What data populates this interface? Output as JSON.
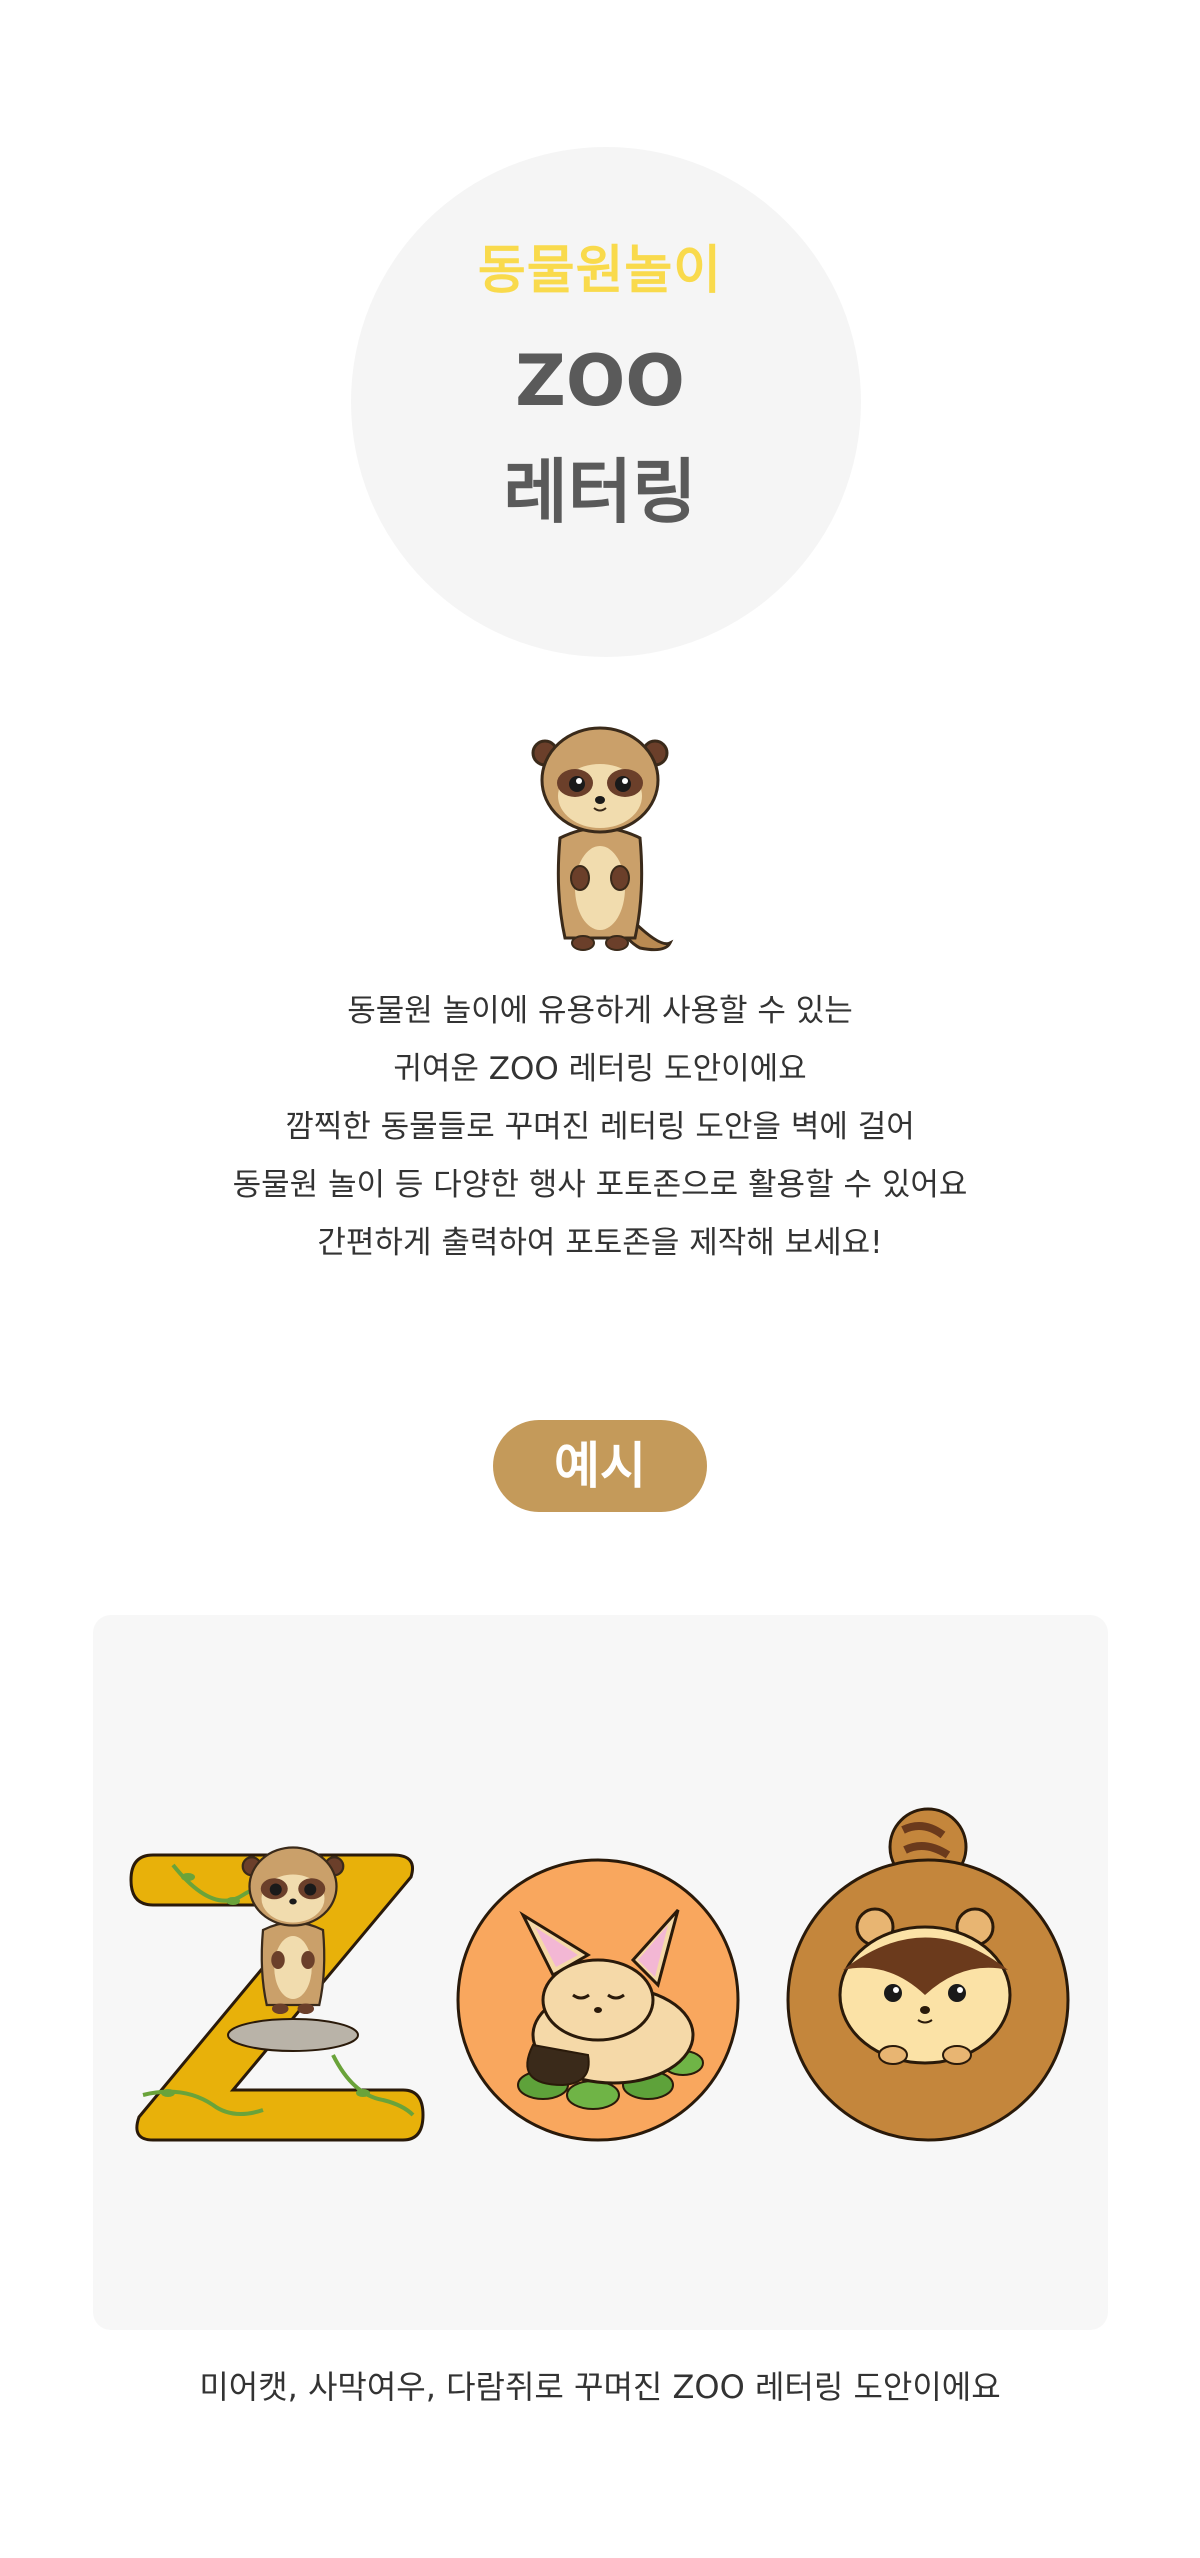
{
  "hero": {
    "subtitle": "동물원놀이",
    "title_line1": "ZOO",
    "title_line2": "레터링"
  },
  "description": {
    "lines": [
      "동물원 놀이에 유용하게 사용할 수 있는",
      "귀여운 ZOO 레터링 도안이에요",
      "깜찍한 동물들로 꾸며진 레터링 도안을 벽에 걸어",
      "동물원 놀이 등 다양한 행사 포토존으로 활용할 수 있어요",
      "간편하게 출력하여 포토존을 제작해 보세요!"
    ]
  },
  "example": {
    "label": "예시",
    "caption": "미어캣, 사막여우, 다람쥐로 꾸며진 ZOO 레터링 도안이에요"
  },
  "colors": {
    "subtitle_yellow": "#f9da4c",
    "title_gray": "#5a5a5a",
    "pill_brown": "#c49a5a",
    "z_letter": "#e8b10a",
    "o_letter_fox": "#f9a75e",
    "o_letter_squirrel": "#c4863c"
  },
  "icons": {
    "mascot": "meerkat-icon",
    "z_animal": "meerkat-icon",
    "o1_animal": "fennec-fox-icon",
    "o2_animal": "squirrel-icon"
  }
}
